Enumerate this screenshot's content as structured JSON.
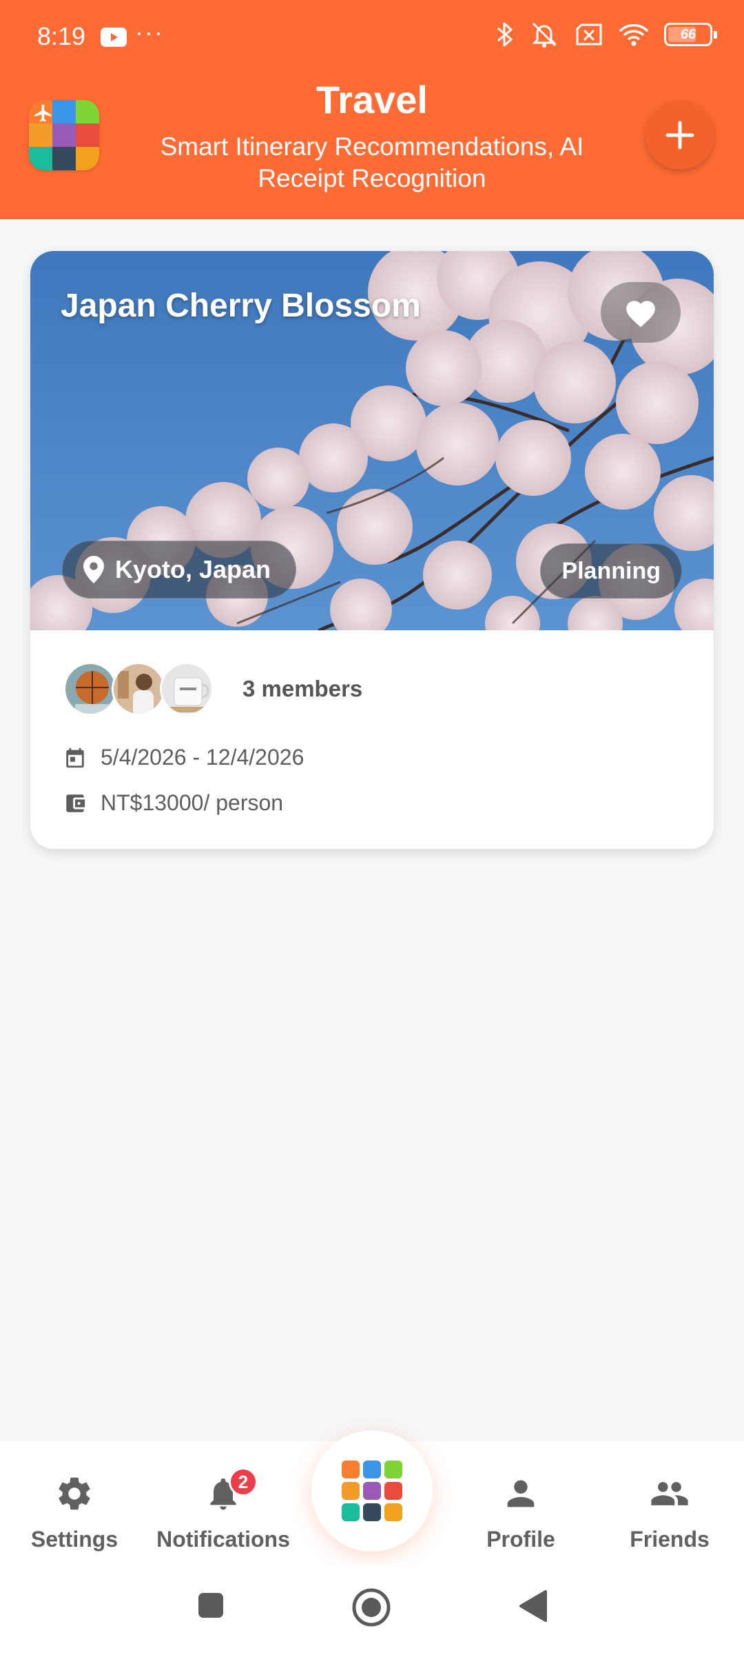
{
  "status_bar": {
    "time": "8:19",
    "dots": "···",
    "battery": "66",
    "icons": [
      "youtube-icon",
      "bluetooth-icon",
      "mute-icon",
      "no-sim-icon",
      "wifi-icon",
      "battery-icon"
    ]
  },
  "header": {
    "title": "Travel",
    "subtitle": "Smart Itinerary Recommendations, AI Receipt Recognition",
    "background": "#fe6b35",
    "add_icon": "plus-icon"
  },
  "trip_card": {
    "title": "Japan Cherry Blossom",
    "location": "Kyoto, Japan",
    "status": "Planning",
    "favorite_icon": "heart-icon",
    "members_label": "3 members",
    "dates": "5/4/2026 - 12/4/2026",
    "budget": "NT$13000/ person"
  },
  "bottom_nav": {
    "items": [
      {
        "label": "Settings",
        "icon": "gear-icon"
      },
      {
        "label": "Notifications",
        "icon": "bell-icon",
        "badge": "2"
      },
      {
        "label": "Profile",
        "icon": "person-icon"
      },
      {
        "label": "Friends",
        "icon": "people-icon"
      }
    ],
    "center_icon": "app-grid-icon"
  },
  "colors": {
    "accent": "#fe6b35",
    "badge": "#ec3e4a",
    "logo_tiles": [
      "#f97d2e",
      "#3d95e9",
      "#7ed433",
      "#f39c2b",
      "#9b59b6",
      "#e74c3c",
      "#1abc9c",
      "#34495e",
      "#f1a11e"
    ]
  }
}
